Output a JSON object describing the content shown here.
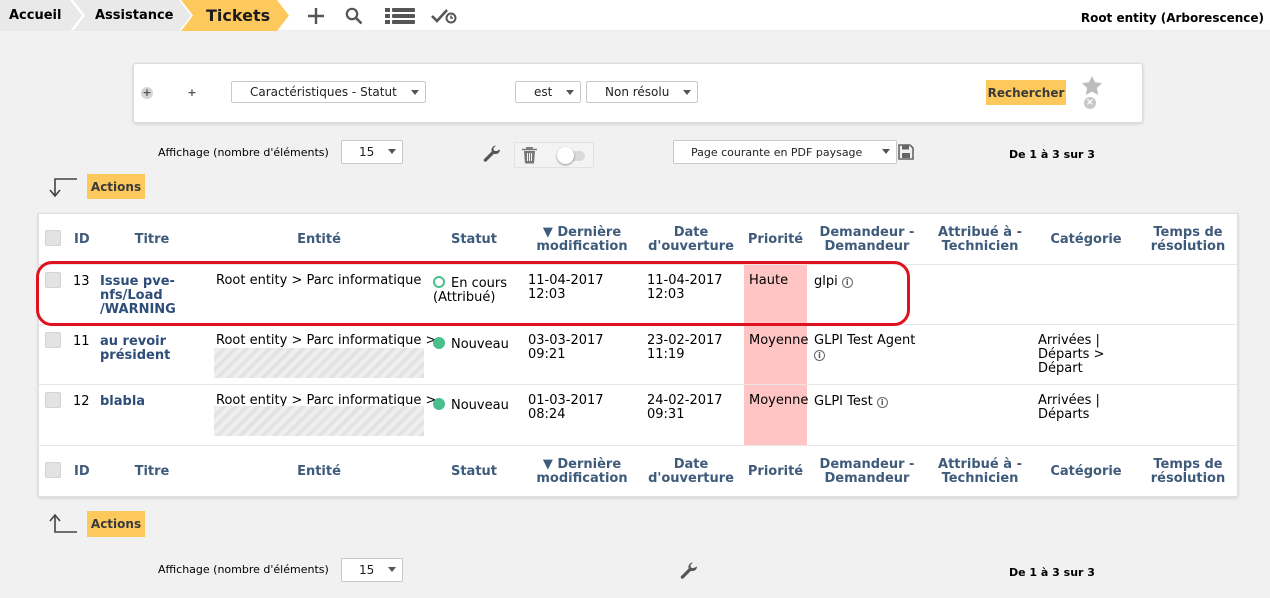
{
  "breadcrumb": {
    "items": [
      "Accueil",
      "Assistance",
      "Tickets"
    ]
  },
  "toolbar": {
    "icons": [
      "plus-icon",
      "search-icon",
      "list-icon",
      "validation-icon"
    ]
  },
  "entity": "Root entity (Arborescence)",
  "search": {
    "field": "Caractéristiques - Statut",
    "operator": "est",
    "value": "Non résolu",
    "submit_label": "Rechercher"
  },
  "display": {
    "label": "Affichage (nombre d'éléments)",
    "count": "15",
    "export": "Page courante en PDF paysage",
    "pagination": "De 1 à 3 sur 3"
  },
  "actions_label": "Actions",
  "columns": {
    "id": "ID",
    "title": "Titre",
    "entity": "Entité",
    "status": "Statut",
    "last_mod_1": "▼ Dernière",
    "last_mod_2": "modification",
    "opened_1": "Date",
    "opened_2": "d'ouverture",
    "priority": "Priorité",
    "requester_1": "Demandeur -",
    "requester_2": "Demandeur",
    "assigned_1": "Attribué à -",
    "assigned_2": "Technicien",
    "category": "Catégorie",
    "resolution_1": "Temps de",
    "resolution_2": "résolution"
  },
  "rows": [
    {
      "id": "13",
      "title": [
        "Issue pve-",
        "nfs/Load",
        "/WARNING"
      ],
      "entity": "Root entity > Parc informatique",
      "status": [
        "En cours",
        "(Attribué)"
      ],
      "last_mod": [
        "11-04-2017",
        "12:03"
      ],
      "opened": [
        "11-04-2017",
        "12:03"
      ],
      "priority": "Haute",
      "requester": "glpi",
      "category": [
        "",
        "",
        ""
      ]
    },
    {
      "id": "11",
      "title": [
        "au revoir",
        "président",
        ""
      ],
      "entity": "Root entity > Parc informatique >",
      "status": [
        "Nouveau",
        ""
      ],
      "last_mod": [
        "03-03-2017",
        "09:21"
      ],
      "opened": [
        "23-02-2017",
        "11:19"
      ],
      "priority": "Moyenne",
      "requester": "GLPI Test Agent",
      "category": [
        "Arrivées |",
        "Départs >",
        "Départ"
      ]
    },
    {
      "id": "12",
      "title": [
        "blabla",
        "",
        ""
      ],
      "entity": "Root entity > Parc informatique >",
      "status": [
        "Nouveau",
        ""
      ],
      "last_mod": [
        "01-03-2017",
        "08:24"
      ],
      "opened": [
        "24-02-2017",
        "09:31"
      ],
      "priority": "Moyenne",
      "requester": "GLPI Test",
      "category": [
        "Arrivées |",
        "Départs",
        ""
      ]
    }
  ],
  "colors": {
    "accent": "#fec95c",
    "header_text": "#3f5b7b",
    "priority_bg": "#ffc4c4",
    "status_green": "#49bf8e",
    "highlight": "#e0121f"
  }
}
